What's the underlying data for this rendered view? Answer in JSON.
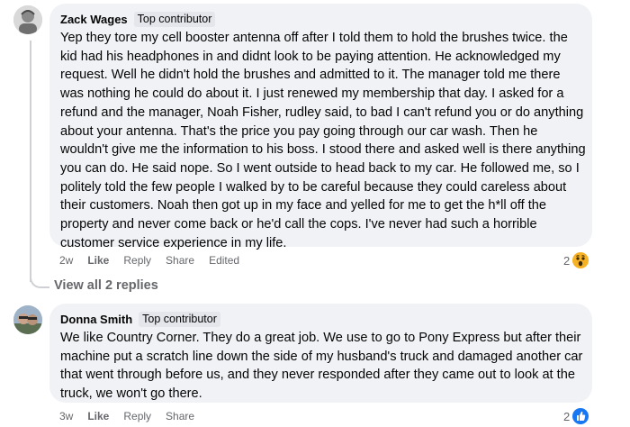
{
  "comments": [
    {
      "author": "Zack Wages",
      "badge": "Top contributor",
      "text": "Yep they tore my cell booster antenna off after I told them to hold the brushes twice. the kid had his headphones in and didnt look to be paying attention. He acknowledged my request. Well he didn't hold the brushes and admitted to it. The manager told me there was nothing he could do about it. I just renewed my membership that day. I asked for a refund and the manager, Noah Fisher, rudley said, to bad I can't refund you or do anything about your antenna. That's the price you pay going through our car wash. Then he wouldn't give me the information to his boss. I stood there and asked well is there anything you can do. He said nope. So I went outside to head back to my car. He followed me, so I politely told the few people I walked by to be careful because they could careless about their customers. Noah then got up in my face and yelled for me to get the h*ll off the property and never come back or he'd call the cops. I've never had such a horrible customer service experience in my life.",
      "time": "2w",
      "like": "Like",
      "reply": "Reply",
      "share": "Share",
      "edited": "Edited",
      "reaction_count": "2",
      "reaction_icon": "wow-emoji-icon"
    },
    {
      "author": "Donna Smith",
      "badge": "Top contributor",
      "text": "We like Country Corner. They do a great job. We use to go to Pony Express but after their machine put a scratch line down the side of my husband's truck and damaged another car that went through before us, and they never responded after they came out to look at the truck, we won't go there.",
      "time": "3w",
      "like": "Like",
      "reply": "Reply",
      "share": "Share",
      "reaction_count": "2",
      "reaction_icon": "like-thumb-icon"
    }
  ],
  "view_replies": "View all 2 replies",
  "colors": {
    "bubble": "#f0f2f5",
    "meta": "#65676b",
    "like_blue": "#1877f2",
    "wow_yellow": "#f7b125"
  }
}
